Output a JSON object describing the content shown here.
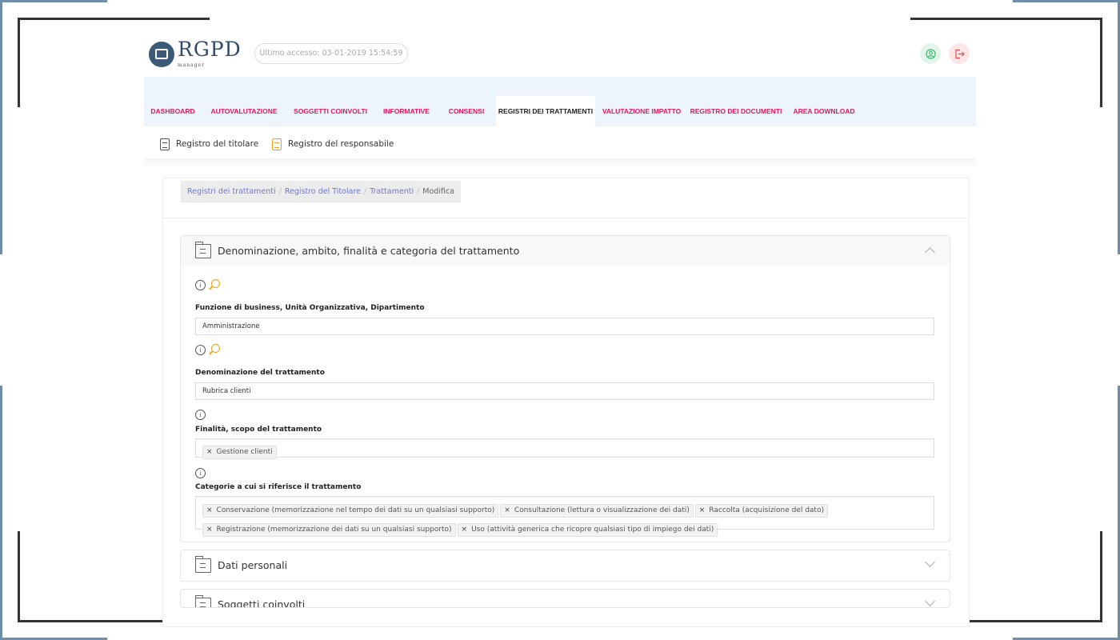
{
  "brand": {
    "name": "RGPD",
    "sub": "manager"
  },
  "header": {
    "last_access": "Ultimo accesso: 03-01-2019 15:54:59"
  },
  "nav": {
    "tabs": [
      {
        "label": "DASHBOARD"
      },
      {
        "label": "AUTOVALUTAZIONE"
      },
      {
        "label": "SOGGETTI COINVOLTI"
      },
      {
        "label": "INFORMATIVE"
      },
      {
        "label": "CONSENSI"
      },
      {
        "label": "REGISTRI DEI TRATTAMENTI"
      },
      {
        "label": "VALUTAZIONE IMPATTO"
      },
      {
        "label": "REGISTRO DEI DOCUMENTI"
      },
      {
        "label": "AREA DOWNLOAD"
      }
    ],
    "active_tab": "REGISTRI DEI TRATTAMENTI"
  },
  "subnav": {
    "items": [
      {
        "label": "Registro del titolare"
      },
      {
        "label": "Registro del responsabile"
      }
    ]
  },
  "breadcrumb": {
    "items": [
      "Registri dei trattamenti",
      "Registro del Titolare",
      "Trattamenti"
    ],
    "current": "Modifica"
  },
  "sections": [
    {
      "title": "Denominazione, ambito, finalità e categoria del trattamento",
      "expanded": true,
      "fields": [
        {
          "label": "Funzione di business, Unità Organizzativa, Dipartimento",
          "value": "Amministrazione"
        },
        {
          "label": "Denominazione del trattamento",
          "value": "Rubrica clienti"
        },
        {
          "label": "Finalità, scopo del trattamento",
          "tags": [
            "Gestione clienti"
          ]
        },
        {
          "label": "Categorie a cui si riferisce il trattamento",
          "tags": [
            "Conservazione (memorizzazione nel tempo dei dati su un qualsiasi supporto)",
            "Consultazione (lettura o visualizzazione dei dati)",
            "Raccolta (acquisizione del dato)",
            "Registrazione (memorizzazione dei dati su un qualsiasi supporto)",
            "Uso (attività generica che ricopre qualsiasi tipo di impiego dei dati)"
          ]
        }
      ]
    },
    {
      "title": "Dati personali",
      "expanded": false
    },
    {
      "title": "Soggetti coinvolti",
      "expanded": false
    }
  ],
  "colors": {
    "nav_text": "#e0195e",
    "accent_orange": "#f0a020",
    "link": "#6b7ad0",
    "brand": "#2f4a6a"
  },
  "icons": [
    "user-icon",
    "logout-icon",
    "document-icon",
    "folder-icon",
    "info-icon",
    "search-icon",
    "chevron-up-icon",
    "chevron-down-icon"
  ]
}
